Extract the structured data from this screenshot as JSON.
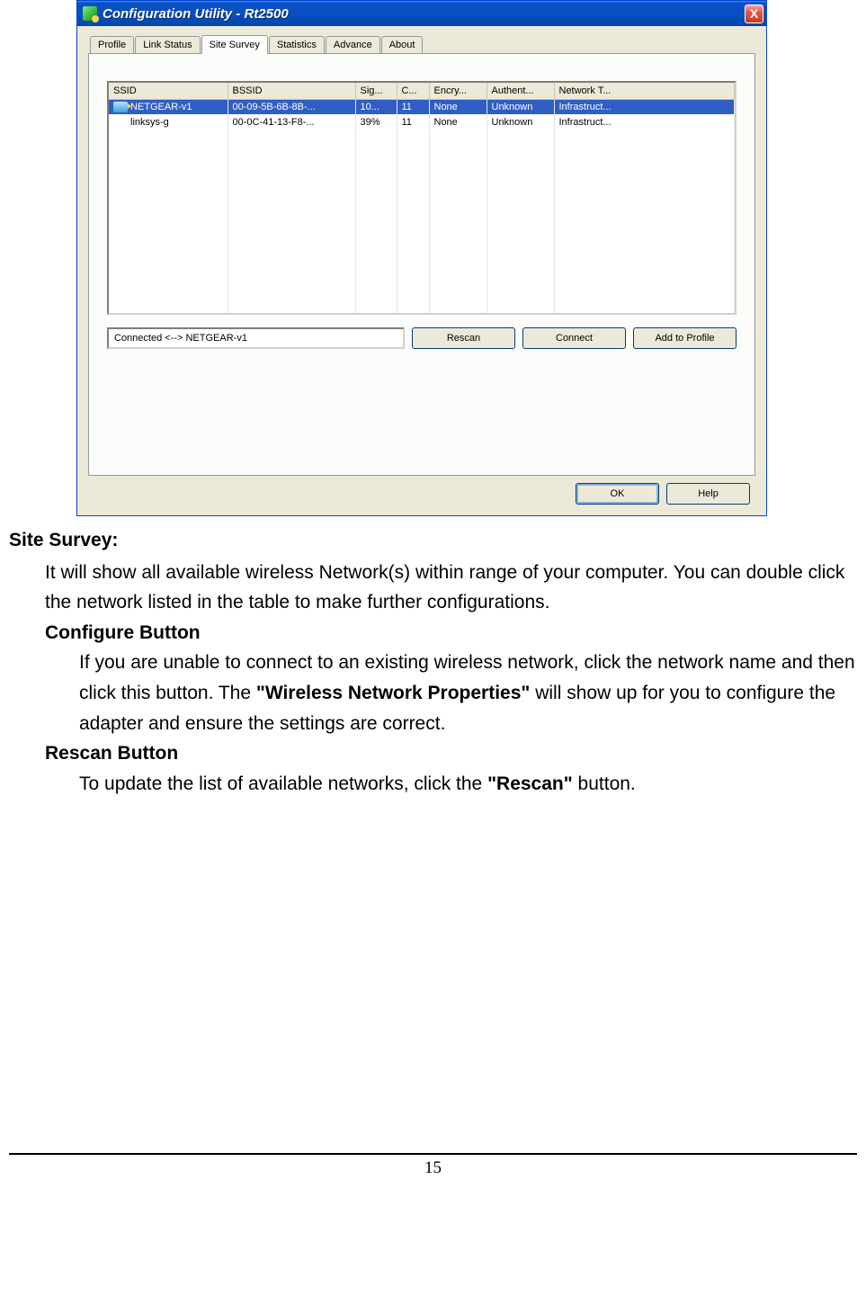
{
  "window": {
    "title": "Configuration Utility - Rt2500",
    "close_label": "X"
  },
  "tabs": [
    "Profile",
    "Link Status",
    "Site Survey",
    "Statistics",
    "Advance",
    "About"
  ],
  "active_tab_index": 2,
  "columns": [
    "SSID",
    "BSSID",
    "Sig...",
    "C...",
    "Encry...",
    "Authent...",
    "Network T..."
  ],
  "rows": [
    {
      "ssid": "NETGEAR-v1",
      "bssid": "00-09-5B-6B-8B-...",
      "sig": "10...",
      "chan": "11",
      "encry": "None",
      "auth": "Unknown",
      "net": "Infrastruct...",
      "selected": true,
      "icon": true
    },
    {
      "ssid": "linksys-g",
      "bssid": "00-0C-41-13-F8-...",
      "sig": "39%",
      "chan": "11",
      "encry": "None",
      "auth": "Unknown",
      "net": "Infrastruct...",
      "selected": false,
      "icon": false
    }
  ],
  "status_text": "Connected <--> NETGEAR-v1",
  "buttons": {
    "rescan": "Rescan",
    "connect": "Connect",
    "add_to_profile": "Add to Profile",
    "ok": "OK",
    "help": "Help"
  },
  "doc": {
    "title": "Site Survey:",
    "para1": "It will show all available wireless Network(s) within range of your computer. You can double click the network listed in the table to make further configurations.",
    "h2a": "Configure Button",
    "para2_a": "If you are unable to connect to an existing wireless network, click the network name and then click this button. The ",
    "para2_bold": "\"Wireless Network Properties\"",
    "para2_b": " will show up for you to configure the adapter and ensure the settings are correct.",
    "h2b": "Rescan Button",
    "para3_a": "To update the list of available networks, click the ",
    "para3_bold": "\"Rescan\"",
    "para3_b": " button."
  },
  "page_number": "15"
}
